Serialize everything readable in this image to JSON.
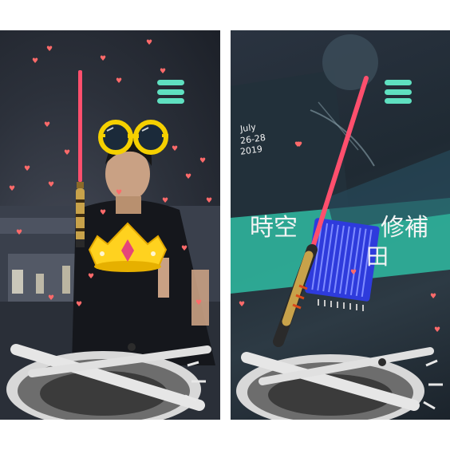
{
  "left_panel": {
    "menu_icon": "hamburger-menu-icon",
    "effects": [
      "lightsaber",
      "round-glasses",
      "crown",
      "heart-particles"
    ]
  },
  "right_panel": {
    "menu_icon": "hamburger-menu-icon",
    "poster": {
      "date_month": "July",
      "date_range": "26-28",
      "date_year": "2019",
      "title_line1": "時空",
      "title_line1b": "修補",
      "title_line2": "田"
    },
    "effects": [
      "lightsaber",
      "microchip",
      "heart-particles"
    ]
  },
  "colors": {
    "saber_blade": "#ff4f6d",
    "glasses": "#f5d000",
    "crown": "#ffd21f",
    "menu": "#5fe0c0",
    "chip": "#2e3bdc",
    "poster": "#2fb49c"
  }
}
